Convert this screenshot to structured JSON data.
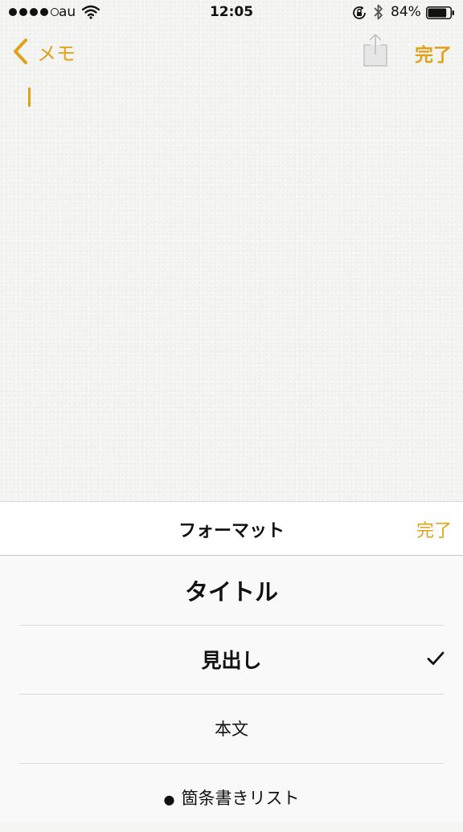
{
  "status_bar": {
    "carrier": "au",
    "time": "12:05",
    "battery_percent": "84%",
    "battery_level": 0.84,
    "signal_bars_filled": 4,
    "signal_bars_total": 5
  },
  "nav": {
    "back_label": "メモ",
    "done_label": "完了"
  },
  "format_panel": {
    "title": "フォーマット",
    "done_label": "完了",
    "options": [
      {
        "label": "タイトル",
        "selected": false
      },
      {
        "label": "見出し",
        "selected": true
      },
      {
        "label": "本文",
        "selected": false
      },
      {
        "label": "箇条書きリスト",
        "selected": false,
        "bullet": "●"
      }
    ]
  },
  "colors": {
    "accent": "#e0a219",
    "paper": "#f4f4f2",
    "panel_bg": "#f9f9f9",
    "header_bg": "#ffffff"
  }
}
